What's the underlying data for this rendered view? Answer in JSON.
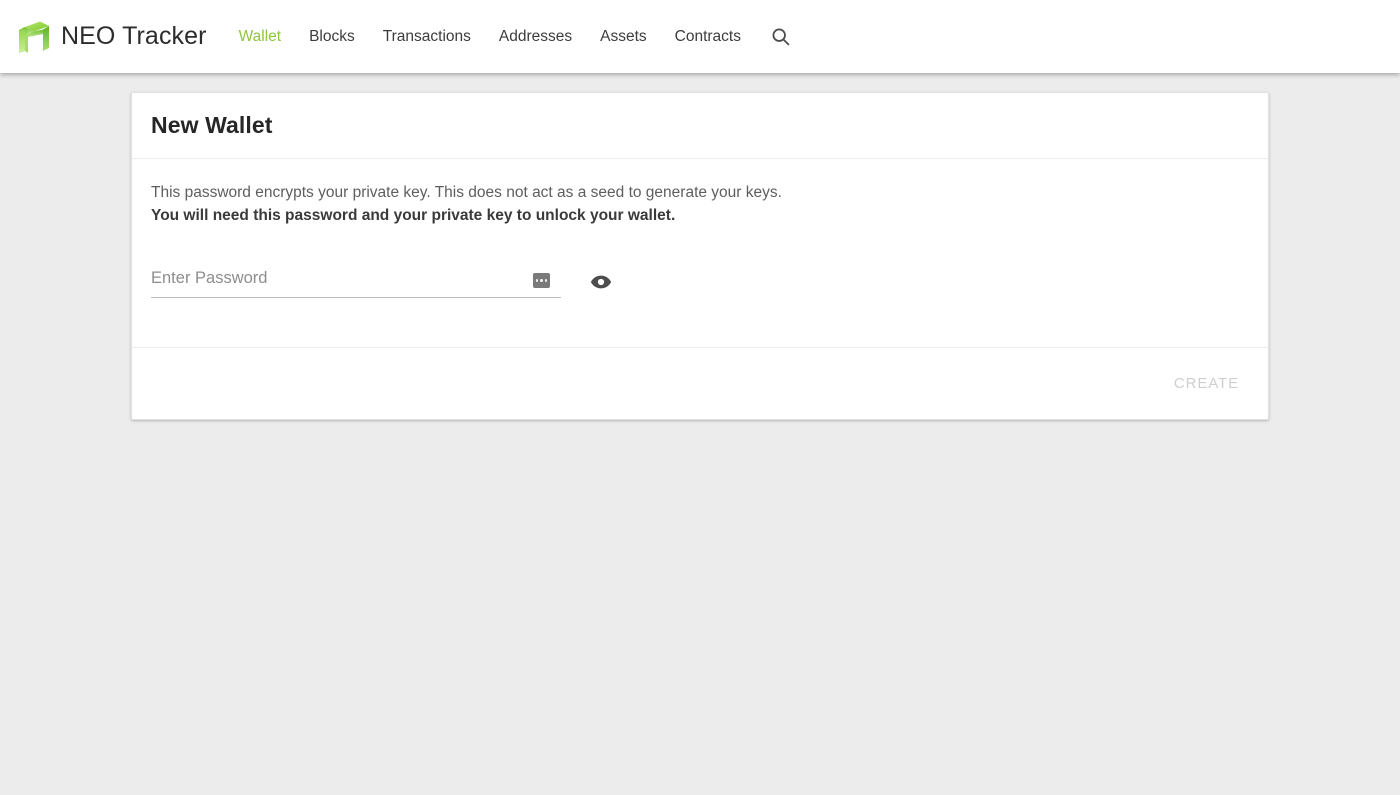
{
  "header": {
    "brand": {
      "name": "NEO Tracker",
      "logo_icon": "neo-logo-icon",
      "logo_color_light": "#9ddb3c",
      "logo_color_mid": "#6fc22c",
      "logo_color_dark": "#4fa718"
    },
    "nav": [
      {
        "label": "Wallet",
        "active": true
      },
      {
        "label": "Blocks",
        "active": false
      },
      {
        "label": "Transactions",
        "active": false
      },
      {
        "label": "Addresses",
        "active": false
      },
      {
        "label": "Assets",
        "active": false
      },
      {
        "label": "Contracts",
        "active": false
      }
    ],
    "search_icon": "search-icon",
    "active_color": "#8ec640",
    "nav_color": "#3d3d3d"
  },
  "card": {
    "title": "New Wallet",
    "description_line_1": "This password encrypts your private key. This does not act as a seed to generate your keys.",
    "description_line_2": "You will need this password and your private key to unlock your wallet.",
    "password_field": {
      "placeholder": "Enter Password",
      "value": "",
      "manager_icon": "password-manager-icon",
      "toggle_icon": "eye-icon"
    },
    "create_label": "CREATE",
    "create_disabled": true
  },
  "page": {
    "background_color": "#ececec",
    "card_background": "#ffffff"
  }
}
